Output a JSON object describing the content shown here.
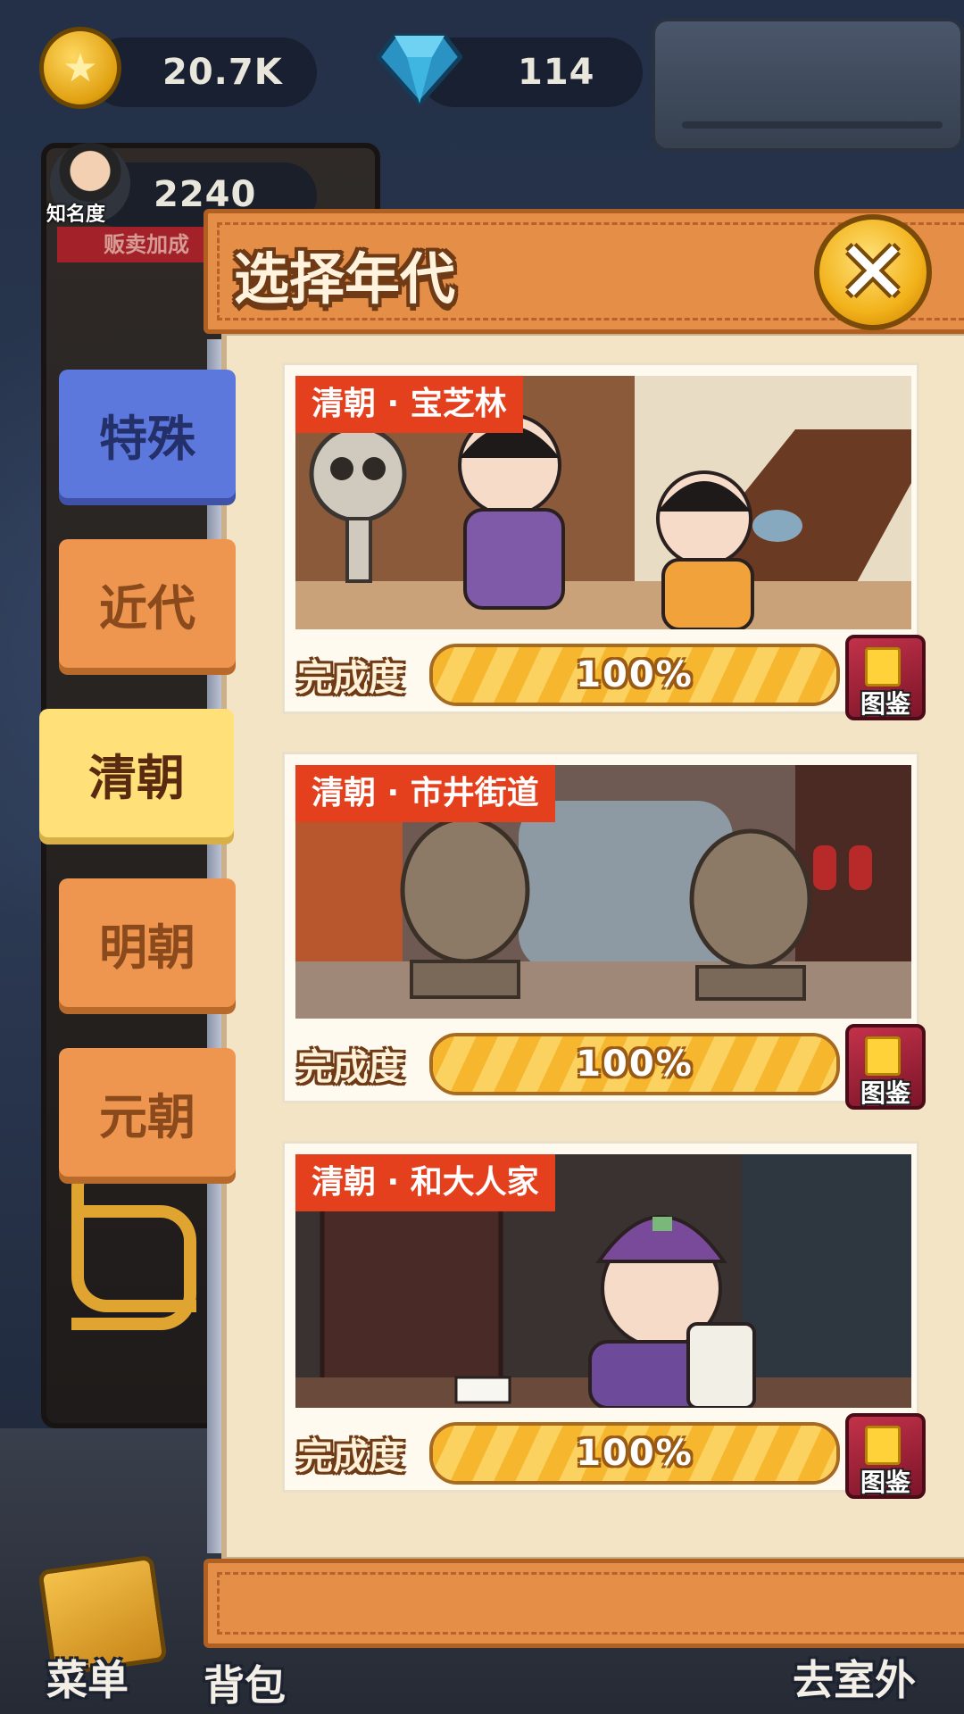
{
  "hud": {
    "coins": "20.7K",
    "gems": "114",
    "fame_value": "2240",
    "fame_label": "知名度",
    "bonus_label": "贩卖加成"
  },
  "dialog": {
    "title": "选择年代",
    "close_icon": "close-x-icon"
  },
  "tabs": [
    {
      "label": "特殊",
      "style": "blue"
    },
    {
      "label": "近代",
      "style": "orange"
    },
    {
      "label": "清朝",
      "style": "active"
    },
    {
      "label": "明朝",
      "style": "orange"
    },
    {
      "label": "元朝",
      "style": "orange"
    }
  ],
  "cards": [
    {
      "tag": "清朝 · 宝芝林",
      "progress_label": "完成度",
      "progress_text": "100%",
      "progress": 1.0,
      "book_label": "图鉴"
    },
    {
      "tag": "清朝 · 市井街道",
      "progress_label": "完成度",
      "progress_text": "100%",
      "progress": 1.0,
      "book_label": "图鉴"
    },
    {
      "tag": "清朝 · 和大人家",
      "progress_label": "完成度",
      "progress_text": "100%",
      "progress": 1.0,
      "book_label": "图鉴"
    }
  ],
  "bottom_nav": {
    "menu": "菜单",
    "bag": "背包",
    "outdoor": "去室外"
  },
  "colors": {
    "accent_orange": "#e58e48",
    "tag_red": "#e5401e",
    "progress_yellow": "#f6b62e",
    "active_tab": "#ffe079",
    "special_tab": "#5d78dc"
  }
}
